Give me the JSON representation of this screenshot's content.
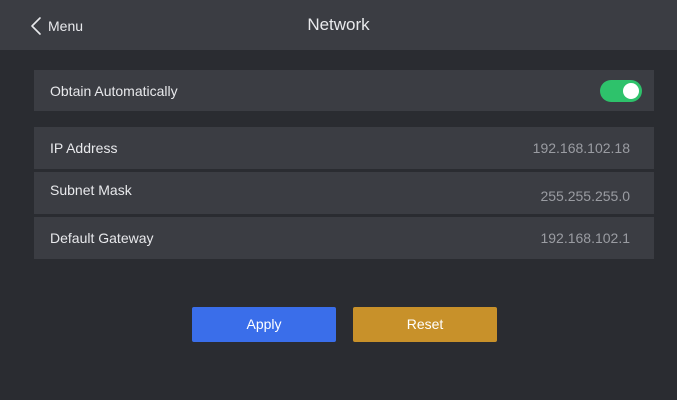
{
  "header": {
    "back_label": "Menu",
    "title": "Network"
  },
  "obtain_automatically": {
    "label": "Obtain Automatically",
    "enabled": true
  },
  "fields": [
    {
      "label": "IP Address",
      "value": "192.168.102.18"
    },
    {
      "label": "Subnet Mask",
      "value": "255.255.255.0"
    },
    {
      "label": "Default Gateway",
      "value": "192.168.102.1"
    }
  ],
  "buttons": {
    "apply_label": "Apply",
    "reset_label": "Reset"
  },
  "colors": {
    "background": "#2a2c31",
    "panel": "#3b3d43",
    "toggle_on": "#2ec26b",
    "apply": "#3a6eea",
    "reset": "#c8912a"
  }
}
